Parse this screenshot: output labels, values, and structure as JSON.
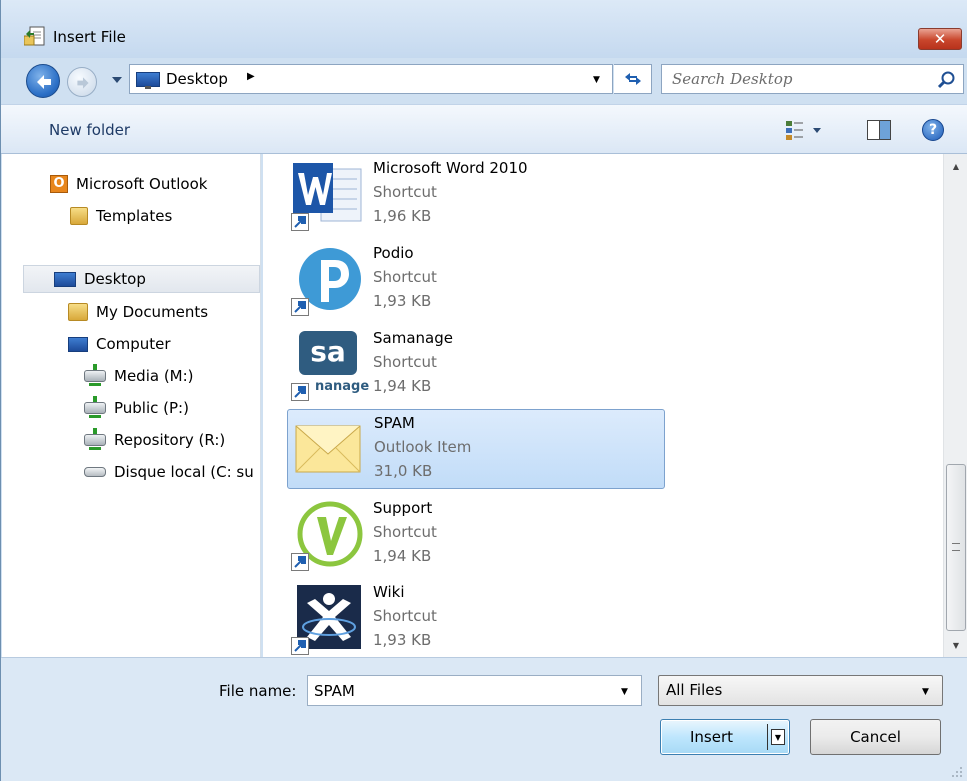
{
  "window": {
    "title": "Insert File",
    "close_label": "✕"
  },
  "address": {
    "location": "Desktop",
    "search_placeholder": "Search Desktop"
  },
  "toolbar": {
    "new_folder": "New folder",
    "help_label": "?"
  },
  "nav": {
    "items": [
      {
        "label": "Microsoft Outlook",
        "icon": "outlook-icon"
      },
      {
        "label": "Templates",
        "icon": "folder-icon"
      },
      {
        "label": "Desktop",
        "icon": "desktop-icon"
      },
      {
        "label": "My Documents",
        "icon": "folder-icon"
      },
      {
        "label": "Computer",
        "icon": "computer-icon"
      },
      {
        "label": "Media (M:)",
        "icon": "network-drive-icon"
      },
      {
        "label": "Public (P:)",
        "icon": "network-drive-icon"
      },
      {
        "label": "Repository (R:)",
        "icon": "network-drive-icon"
      },
      {
        "label": "Disque local (C: su",
        "icon": "local-disk-icon"
      }
    ]
  },
  "files": [
    {
      "name": "Microsoft Word 2010",
      "type": "Shortcut",
      "size": "1,96 KB",
      "icon": "word-icon"
    },
    {
      "name": "Podio",
      "type": "Shortcut",
      "size": "1,93 KB",
      "icon": "podio-icon"
    },
    {
      "name": "Samanage",
      "type": "Shortcut",
      "size": "1,94 KB",
      "icon": "samanage-icon",
      "icon_text": "sa",
      "icon_caption": "nanage"
    },
    {
      "name": "SPAM",
      "type": "Outlook Item",
      "size": "31,0 KB",
      "icon": "envelope-icon"
    },
    {
      "name": "Support",
      "type": "Shortcut",
      "size": "1,94 KB",
      "icon": "support-icon"
    },
    {
      "name": "Wiki",
      "type": "Shortcut",
      "size": "1,93 KB",
      "icon": "wiki-icon"
    }
  ],
  "bottom": {
    "file_name_label": "File name:",
    "file_name_value": "SPAM",
    "file_type_value": "All Files",
    "insert_label": "Insert",
    "cancel_label": "Cancel"
  },
  "colors": {
    "selection": "#c1dcf8",
    "selection_border": "#7da2ce",
    "close_red": "#c9462c",
    "accent_blue": "#2b6fc6"
  }
}
